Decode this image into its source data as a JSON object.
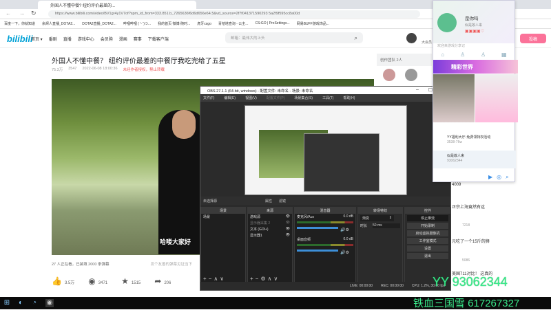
{
  "browser": {
    "tab_title": "外国人不懂中餐? 纽约评价最差的...",
    "url": "https://www.bilibili.com/video/BV1gr4y1V7of?spm_id_from=333.851.b_7265636f6d6d656e64.5&vd_source=2f7f041371590293 5a2f9f595cc8a00d",
    "bookmarks": [
      "百度一下，你就知道",
      "余烬人直播_DOTA2...",
      "DOTA2直播_DOTA2...",
      "哔哩哔哩 ( '- ')つ...",
      "我的首页 微博-随时...",
      "虎牙csgo",
      "青桔塔查询 - 公主...",
      "CS:GO | ProSettings...",
      "网易BUFF游戏饰品..."
    ]
  },
  "site": {
    "logo": "bilibili",
    "nav": [
      "首页 ▾",
      "番剧",
      "直播",
      "游戏中心",
      "会员购",
      "漫画",
      "赛事",
      "下载客户端"
    ],
    "search_placeholder": "邮箱：最伟大的上头",
    "upload": "投稿",
    "user_label": "大会员"
  },
  "video": {
    "title": "外国人不懂中餐？ 纽约评价最差的中餐厅我吃完给了五星",
    "views": "75.3万",
    "danmaku_count": "3547",
    "date": "2022-06-08 18:00:36",
    "notice": "未经作者授权，禁止转载",
    "subtitle": "哈喽大家好",
    "watching": "27 人正在看，已装填 2000 条弹幕",
    "danmaku_placeholder": "发个友善的弹幕见证当下",
    "likes": "3.5万",
    "coins": "3471",
    "favorites": "1515",
    "shares": "206"
  },
  "team": {
    "label": "创作团队",
    "count": "2人"
  },
  "obs": {
    "title": "OBS 27.1.1 (64-bit, windows) - 配置文件: 未命名 - 场景: 未命名",
    "menu": [
      "文件(F)",
      "编辑(E)",
      "视图(V)",
      "配置文件(P)",
      "场景集合(S)",
      "工具(T)",
      "帮助(H)"
    ],
    "no_source": "未选择源",
    "props": "属性",
    "filters": "滤镜",
    "docks": {
      "scenes": "场景",
      "sources": "来源",
      "mixer": "混音器",
      "transitions": "转场特效",
      "controls": "控件"
    },
    "scene_items": [
      "场景"
    ],
    "source_items": [
      "游戏源",
      "显示器采集 2",
      "文本 (GDI+)",
      "显示器1"
    ],
    "mixer": [
      {
        "name": "麦克风/Aux",
        "db": "0.0 dB"
      },
      {
        "name": "桌面音频",
        "db": "0.0 dB"
      }
    ],
    "transition": {
      "value": "渐变",
      "duration_label": "时长",
      "duration": "50 ms"
    },
    "controls": [
      "停止推流",
      "开始录制",
      "启动虚拟摄像机",
      "工作室模式",
      "设置",
      "退出"
    ],
    "status": {
      "live": "LIVE: 00:00:00",
      "rec": "REC: 00:00:00",
      "cpu": "CPU: 1.2%, 30.00 fps"
    }
  },
  "qq": {
    "name": "是你吗",
    "signature": "似是故人来",
    "hint": "欢迎来游戏分享记",
    "banner": "精彩世界",
    "items": [
      {
        "title": "YY福利大厅-免费领特权活动",
        "sub": "3538-76w"
      },
      {
        "title": "似是故人来",
        "sub": "93062344"
      }
    ]
  },
  "comments": [
    {
      "text": "正宗上海竟然有这",
      "sub": "7218"
    },
    {
      "text": "元吃了一个15斤的狮",
      "sub": "5086"
    },
    {
      "text": "美国711对比！ 这真的",
      "sub": ""
    }
  ],
  "comment_side": [
    "4009"
  ],
  "watermark": {
    "line1": "YY 93062344",
    "line2": "铁血三国雪 617267327"
  },
  "colors": {
    "bili_blue": "#00a1d6",
    "bili_pink": "#fb7299",
    "obs_bg": "#2b2b2b",
    "watermark": "#39e88a"
  }
}
